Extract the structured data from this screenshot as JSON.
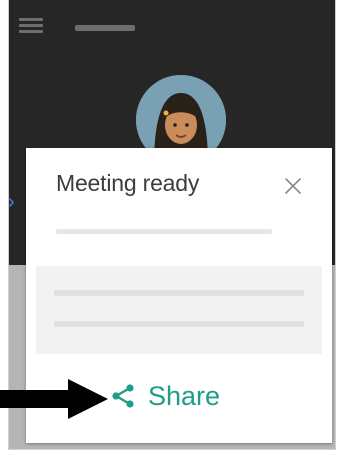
{
  "header": {
    "menu_icon": "hamburger-menu-icon",
    "title_placeholder": ""
  },
  "profile": {
    "avatar_icon": "user-avatar-icon"
  },
  "dialog": {
    "title": "Meeting ready",
    "close_icon": "close-icon",
    "share": {
      "label": "Share",
      "icon": "share-icon",
      "color": "#1f9e86"
    }
  },
  "annotation": {
    "arrow_icon": "arrow-right-icon",
    "arrow_color": "#000000"
  }
}
